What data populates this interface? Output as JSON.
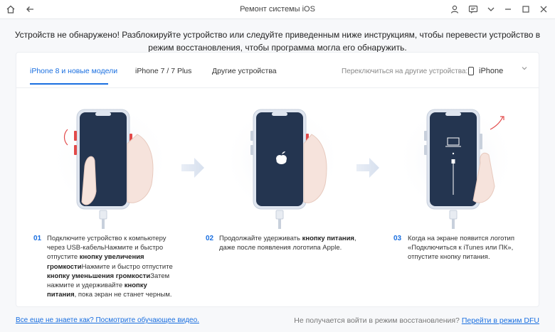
{
  "window": {
    "title": "Ремонт системы iOS"
  },
  "notice": "Устройств не обнаружено! Разблокируйте устройство или следуйте приведенным ниже инструкциям, чтобы перевести устройство в режим восстановления, чтобы программа могла его обнаружить.",
  "tabs": [
    {
      "label": "iPhone 8 и новые модели",
      "active": true
    },
    {
      "label": "iPhone 7 / 7 Plus",
      "active": false
    },
    {
      "label": "Другие устройства",
      "active": false
    }
  ],
  "switch_devices": {
    "label": "Переключиться на другие устройства:",
    "selected": "iPhone"
  },
  "steps": [
    {
      "num": "01",
      "parts": [
        {
          "t": "Подключите устройство к компьютеру через USB-кабельНажмите и быстро отпустите ",
          "b": false
        },
        {
          "t": "кнопку увеличения громкости",
          "b": true
        },
        {
          "t": "Нажмите и быстро отпустите ",
          "b": false
        },
        {
          "t": "кнопку уменьшения громкости",
          "b": true
        },
        {
          "t": "Затем нажмите и удерживайте ",
          "b": false
        },
        {
          "t": "кнопку питания",
          "b": true
        },
        {
          "t": ", пока экран не станет черным.",
          "b": false
        }
      ]
    },
    {
      "num": "02",
      "parts": [
        {
          "t": "Продолжайте удерживать ",
          "b": false
        },
        {
          "t": "кнопку питания",
          "b": true
        },
        {
          "t": ", даже после появления логотипа Apple.",
          "b": false
        }
      ]
    },
    {
      "num": "03",
      "parts": [
        {
          "t": "Когда на экране появится логотип «Подключиться к iTunes или ПК», отпустите кнопку питания.",
          "b": false
        }
      ]
    }
  ],
  "footer": {
    "tutorial_link": "Все еще не знаете как? Посмотрите обучающее видео.",
    "recovery_question": "Не получается войти в режим восстановления?",
    "dfu_link": "Перейти в режим DFU"
  },
  "colors": {
    "accent": "#1a6fe0",
    "screen": "#243550",
    "button_red": "#e24a4a"
  }
}
